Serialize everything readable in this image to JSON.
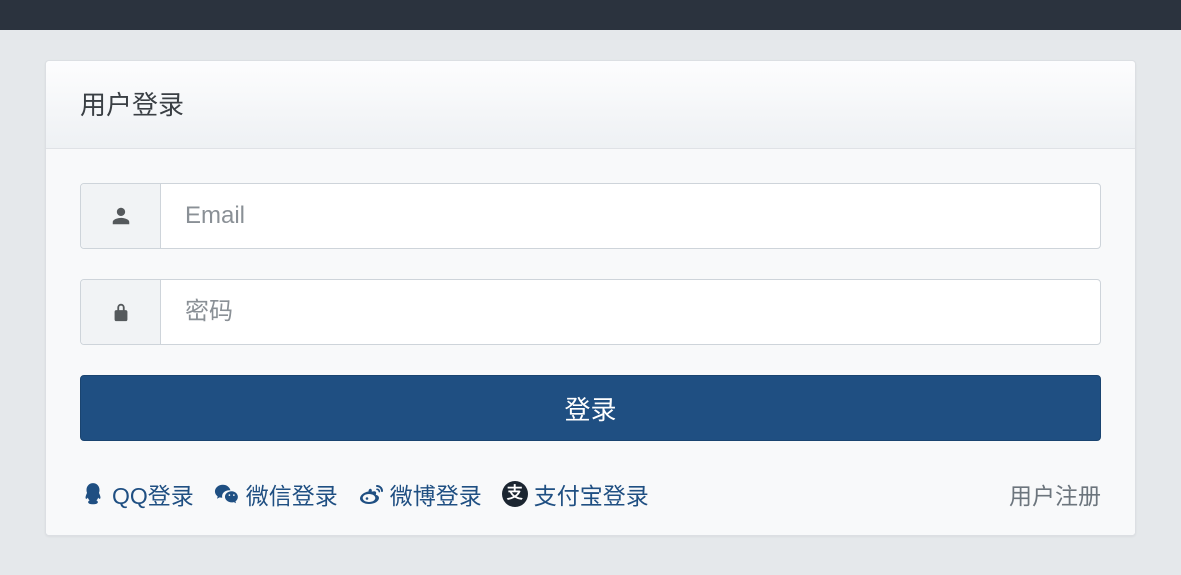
{
  "panel": {
    "title": "用户登录"
  },
  "fields": {
    "email_placeholder": "Email",
    "password_placeholder": "密码"
  },
  "buttons": {
    "login": "登录"
  },
  "social": {
    "qq": "QQ登录",
    "wechat": "微信登录",
    "weibo": "微博登录",
    "alipay": "支付宝登录",
    "alipay_glyph": "支"
  },
  "links": {
    "register": "用户注册"
  }
}
